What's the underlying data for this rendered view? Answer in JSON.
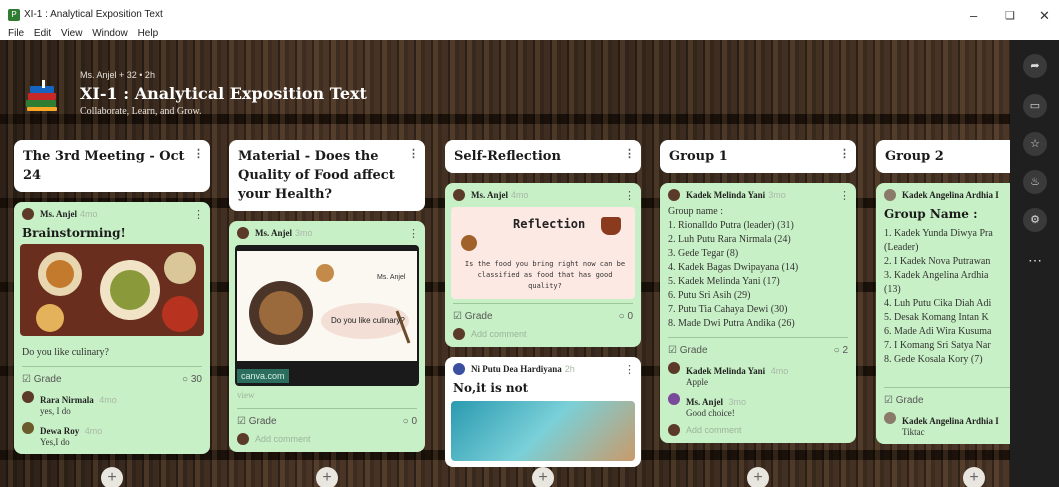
{
  "window": {
    "title": "XI-1 : Analytical Exposition Text",
    "menu": [
      "File",
      "Edit",
      "View",
      "Window",
      "Help"
    ]
  },
  "header": {
    "meta": "Ms. Anjel + 32 • 2h",
    "title": "XI-1 : Analytical Exposition Text",
    "subtitle": "Collaborate, Learn, and Grow."
  },
  "columns": [
    {
      "title": "The 3rd Meeting - Oct 24",
      "cards": [
        {
          "author": "Ms. Anjel",
          "time": "4mo",
          "title": "Brainstorming!",
          "text": "Do you like culinary?",
          "grade": "Grade",
          "comments": "30",
          "comment_list": [
            {
              "who": "Rara Nirmala",
              "time": "4mo",
              "body": "yes, I do"
            },
            {
              "who": "Dewa Roy",
              "time": "4mo",
              "body": "Yes,I do"
            }
          ]
        }
      ]
    },
    {
      "title": "Material - Does the Quality of Food affect your Health?",
      "cards": [
        {
          "author": "Ms. Anjel",
          "time": "3mo",
          "slide_name": "Ms. Anjel",
          "slide_text": "Do you like culinary?",
          "link_domain": "canva.com",
          "link_action": "view",
          "grade": "Grade",
          "comments": "0",
          "add_comment": "Add comment"
        }
      ]
    },
    {
      "title": "Self-Reflection",
      "cards": [
        {
          "author": "Ms. Anjel",
          "time": "4mo",
          "reflection_title": "Reflection",
          "reflection_text": "Is the food you bring right now can be classified as food that has good quality?",
          "grade": "Grade",
          "comments": "0",
          "add_comment": "Add comment"
        },
        {
          "author": "Ni Putu Dea Hardiyana",
          "time": "2h",
          "title": "No,it is not"
        }
      ]
    },
    {
      "title": "Group 1",
      "cards": [
        {
          "author": "Kadek Melinda Yani",
          "time": "3mo",
          "text_lines": [
            "Group name :",
            "1. Rionalldo Putra (leader) (31)",
            "2. Luh Putu Rara Nirmala (24)",
            "3. Gede Tegar (8)",
            "4. Kadek Bagas Dwipayana (14)",
            "5. Kadek Melinda Yani (17)",
            "6. Putu Sri Asih (29)",
            "7. Putu Tia Cahaya Dewi (30)",
            "8. Made Dwi Putra Andika (26)"
          ],
          "grade": "Grade",
          "comments": "2",
          "comment_list": [
            {
              "who": "Kadek Melinda Yani",
              "time": "4mo",
              "body": "Apple"
            },
            {
              "who": "Ms. Anjel",
              "time": "3mo",
              "body": "Good choice!"
            }
          ],
          "add_comment": "Add comment"
        }
      ]
    },
    {
      "title": "Group 2",
      "cards": [
        {
          "author": "Kadek Angelina Ardhia I",
          "title": "Group Name :",
          "text_lines": [
            "1. Kadek Yunda Diwya Pra",
            "(Leader)",
            "2. I Kadek Nova Putrawan",
            "3. Kadek Angelina Ardhia",
            "(13)",
            "4. Luh Putu Cika Diah Adi",
            "5. Desak Komang Intan K",
            "6. Made Adi Wira Kusuma",
            "7. I Komang Sri Satya Nar",
            "8. Gede Kosala Kory (7)"
          ],
          "grade": "Grade",
          "comment_list": [
            {
              "who": "Kadek Angelina Ardhia I",
              "time": "",
              "body": "Tiktac"
            }
          ]
        }
      ]
    }
  ],
  "colors": {
    "card_bg": "#c8f0c6",
    "rail_bg": "#1f1f1f"
  }
}
